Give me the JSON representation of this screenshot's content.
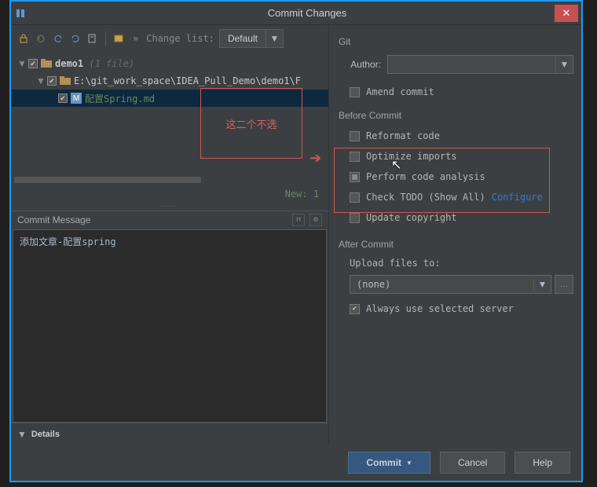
{
  "window": {
    "title": "Commit Changes"
  },
  "toolbar": {
    "changelist_prefix": "»",
    "changelist_label": "Change list:",
    "changelist_value": "Default"
  },
  "tree": {
    "root": {
      "name": "demo1",
      "suffix": "(1 file)"
    },
    "path": "E:\\git_work_space\\IDEA_Pull_Demo\\demo1\\F",
    "file": {
      "badge": "M",
      "name": "配置Spring.md"
    },
    "status_new": "New: 1"
  },
  "annotation": {
    "text": "这二个不选"
  },
  "commit_message": {
    "label": "Commit Message",
    "value": "添加文章-配置spring"
  },
  "details": {
    "label": "Details"
  },
  "git": {
    "header": "Git",
    "author_label": "Author:",
    "author_value": "",
    "amend": "Amend commit"
  },
  "before_commit": {
    "header": "Before Commit",
    "reformat": "Reformat code",
    "optimize": "Optimize imports",
    "analysis": "Perform code analysis",
    "todo": "Check TODO (Show All)",
    "configure": "Configure",
    "copyright": "Update copyright"
  },
  "after_commit": {
    "header": "After Commit",
    "upload_label": "Upload files to:",
    "upload_value": "(none)",
    "always_selected": "Always use selected server"
  },
  "footer": {
    "commit": "Commit",
    "cancel": "Cancel",
    "help": "Help"
  }
}
